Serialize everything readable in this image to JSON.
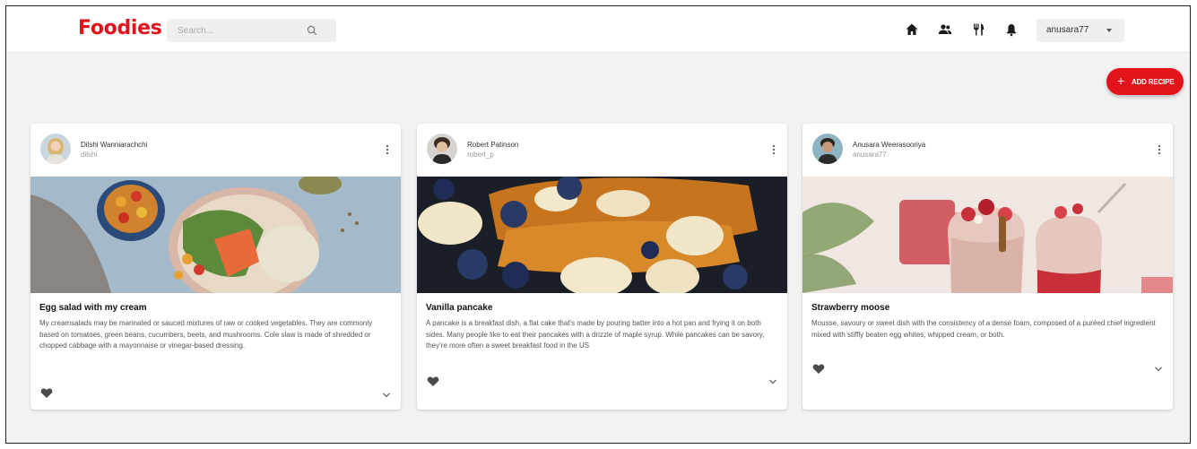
{
  "header": {
    "logo": "Foodies",
    "search_placeholder": "Search...",
    "nav_icons": [
      "home-icon",
      "people-icon",
      "restaurant-icon",
      "notifications-icon"
    ],
    "user_select_value": "anusara77"
  },
  "actions": {
    "add_recipe_label": "ADD RECIPE",
    "add_recipe_icon": "plus-icon"
  },
  "colors": {
    "brand": "#e3131b",
    "background": "#f2f2f2",
    "card": "#ffffff"
  },
  "posts": [
    {
      "author": "Dilshi Wanniarachchi",
      "handle": "dilshi",
      "title": "Egg salad with my cream",
      "description": "My creamsalads may be marinated or sauced mixtures of raw or cooked vegetables. They are commonly based on tomatoes, green beans, cucumbers, beets, and mushrooms. Cole slaw is made of shredded or chopped cabbage with a mayonnaise or vinegar-based dressing."
    },
    {
      "author": "Robert Patinson",
      "handle": "robert_p",
      "title": "Vanilla pancake",
      "description": "A pancake is a breakfast dish, a flat cake that's made by pouring batter into a hot pan and frying it on both sides. Many people like to eat their pancakes with a drizzle of maple syrup. While pancakes can be savory, they're more often a sweet breakfast food in the US"
    },
    {
      "author": "Anusara Weerasooriya",
      "handle": "anusara77",
      "title": "Strawberry moose",
      "description": "Mousse, savoury or sweet dish with the consistency of a dense foam, composed of a puréed chief ingredient mixed with stiffly beaten egg whites, whipped cream, or both."
    }
  ]
}
